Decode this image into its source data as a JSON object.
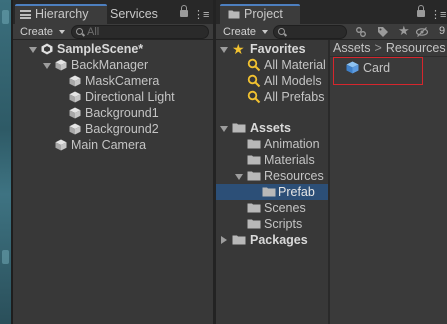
{
  "hierarchy": {
    "tab_label": "Hierarchy",
    "services_label": "Services",
    "create_label": "Create",
    "search_placeholder": "All",
    "scene": {
      "name": "SampleScene*",
      "items": [
        {
          "label": "BackManager"
        },
        {
          "label": "MaskCamera"
        },
        {
          "label": "Directional Light"
        },
        {
          "label": "Background1"
        },
        {
          "label": "Background2"
        },
        {
          "label": "Main Camera"
        }
      ]
    }
  },
  "project": {
    "tab_label": "Project",
    "create_label": "Create",
    "hidden_count": "9",
    "favorites": {
      "label": "Favorites",
      "items": [
        {
          "label": "All Material"
        },
        {
          "label": "All Models"
        },
        {
          "label": "All Prefabs"
        }
      ]
    },
    "assets": {
      "label": "Assets",
      "items": [
        {
          "label": "Animation"
        },
        {
          "label": "Materials"
        },
        {
          "label": "Resources"
        },
        {
          "label": "Prefab"
        },
        {
          "label": "Scenes"
        },
        {
          "label": "Scripts"
        }
      ]
    },
    "packages_label": "Packages",
    "breadcrumb": [
      "Assets",
      "Resources"
    ],
    "breadcrumb_sep": ">",
    "content": [
      {
        "label": "Card",
        "icon": "prefab-icon"
      }
    ]
  },
  "colors": {
    "selection": "#2c4f77",
    "highlight_box": "#d6262d",
    "tab_accent": "#4d7fbf",
    "folder": "#b8b8b8"
  }
}
